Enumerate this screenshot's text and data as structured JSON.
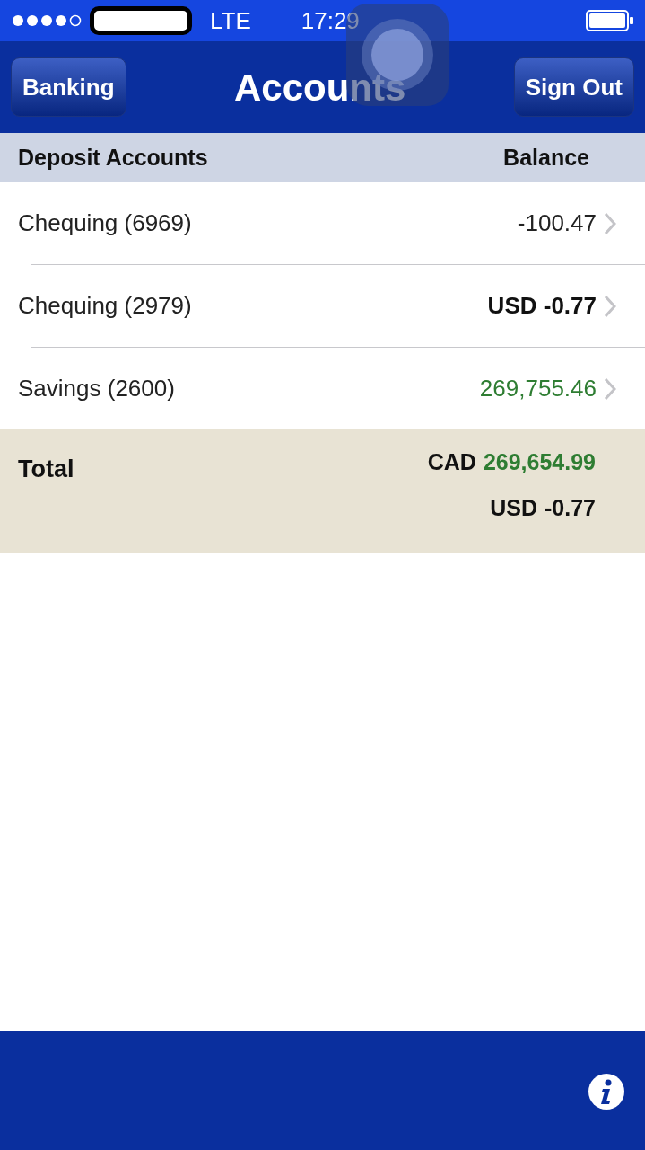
{
  "status_bar": {
    "network": "LTE",
    "time": "17:29"
  },
  "nav": {
    "left_button": "Banking",
    "title": "Accounts",
    "right_button": "Sign Out"
  },
  "table": {
    "columns": [
      "Deposit Accounts",
      "Balance"
    ],
    "rows": [
      {
        "name": "Chequing (6969)",
        "amount": "-100.47",
        "kind": "plain"
      },
      {
        "name": "Chequing (2979)",
        "amount": "USD -0.77",
        "kind": "bold"
      },
      {
        "name": "Savings (2600)",
        "amount": "269,755.46",
        "kind": "positive"
      }
    ]
  },
  "total": {
    "label": "Total",
    "lines": [
      {
        "currency": "CAD",
        "amount": "269,654.99",
        "kind": "positive"
      },
      {
        "currency": "USD",
        "amount": "-0.77",
        "kind": "plain"
      }
    ]
  }
}
